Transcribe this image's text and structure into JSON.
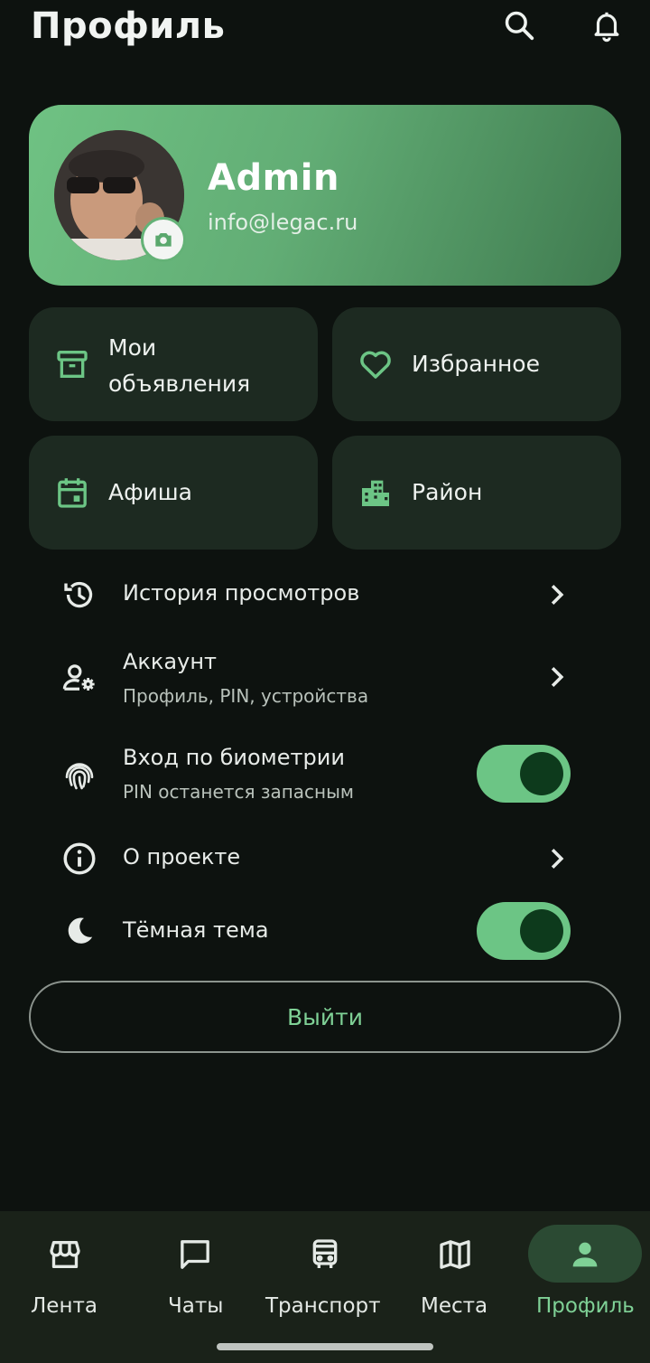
{
  "header": {
    "title": "Профиль",
    "search_icon": "search-icon",
    "bell_icon": "bell-icon"
  },
  "profile": {
    "name": "Admin",
    "email": "info@legac.ru",
    "camera_icon": "camera-icon"
  },
  "tiles": [
    {
      "label_line1": "Мои",
      "label_line2": "объявления",
      "icon": "archive-box-icon"
    },
    {
      "label": "Избранное",
      "icon": "heart-icon"
    },
    {
      "label": "Афиша",
      "icon": "calendar-icon"
    },
    {
      "label": "Район",
      "icon": "buildings-icon"
    }
  ],
  "menu": {
    "history": {
      "title": "История просмотров",
      "icon": "history-icon"
    },
    "account": {
      "title": "Аккаунт",
      "subtitle": "Профиль, PIN, устройства",
      "icon": "user-settings-icon"
    },
    "biometrics": {
      "title": "Вход по биометрии",
      "subtitle": "PIN останется запасным",
      "icon": "fingerprint-icon",
      "enabled": true
    },
    "about": {
      "title": "О проекте",
      "icon": "info-icon"
    },
    "dark_theme": {
      "title": "Тёмная тема",
      "icon": "moon-icon",
      "enabled": true
    }
  },
  "logout_label": "Выйти",
  "nav": [
    {
      "label": "Лента",
      "icon": "storefront-icon"
    },
    {
      "label": "Чаты",
      "icon": "chat-icon"
    },
    {
      "label": "Транспорт",
      "icon": "bus-icon"
    },
    {
      "label": "Места",
      "icon": "map-icon"
    },
    {
      "label": "Профиль",
      "icon": "person-icon",
      "active": true
    }
  ],
  "colors": {
    "background": "#0d120f",
    "accent": "#6cc585",
    "tile": "#1d2a21",
    "nav_active": "#7fd196"
  }
}
